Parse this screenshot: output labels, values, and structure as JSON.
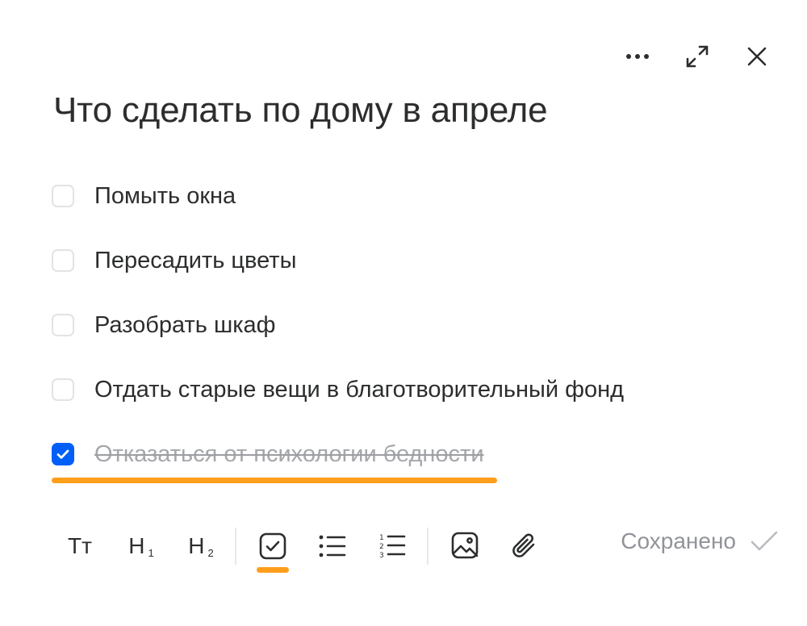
{
  "header": {
    "more_icon": "more-horizontal-icon",
    "expand_icon": "expand-icon",
    "close_icon": "close-icon"
  },
  "note": {
    "title": "Что сделать по дому в апреле",
    "items": [
      {
        "text": "Помыть окна",
        "checked": false
      },
      {
        "text": "Пересадить цветы",
        "checked": false
      },
      {
        "text": "Разобрать шкаф",
        "checked": false
      },
      {
        "text": "Отдать старые вещи в благотворительный фонд",
        "checked": false
      },
      {
        "text": "Отказаться от психологии бедности",
        "checked": true
      }
    ]
  },
  "toolbar": {
    "text_style_label": "Тт",
    "h1_label": "H",
    "h1_sub": "1",
    "h2_label": "H",
    "h2_sub": "2",
    "checklist_icon": "checkbox-icon",
    "bullet_icon": "bullet-list-icon",
    "numbered_icon": "numbered-list-icon",
    "image_icon": "image-icon",
    "attach_icon": "paperclip-icon",
    "status_text": "Сохранено"
  },
  "colors": {
    "text": "#2c2d2e",
    "accent_blue": "#005ff9",
    "accent_orange": "#ff9e1b",
    "muted": "#919399"
  }
}
